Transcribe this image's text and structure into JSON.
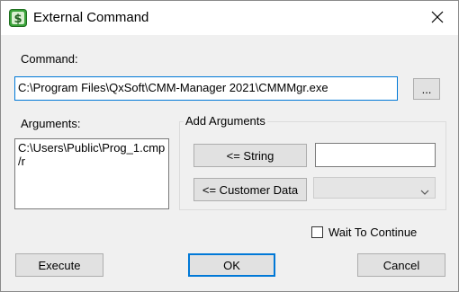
{
  "window": {
    "title": "External Command",
    "close_icon": "close-icon",
    "app_icon": "dollar-app-icon"
  },
  "command": {
    "label": "Command:",
    "value": "C:\\Program Files\\QxSoft\\CMM-Manager 2021\\CMMMgr.exe",
    "browse_label": "..."
  },
  "arguments": {
    "label": "Arguments:",
    "lines": [
      "C:\\Users\\Public\\Prog_1.cmp",
      "/r"
    ]
  },
  "add_arguments": {
    "title": "Add Arguments",
    "string_button": "<= String",
    "string_value": "",
    "customer_data_button": "<= Customer Data",
    "customer_data_selected": ""
  },
  "wait_to_continue": {
    "label": "Wait To Continue",
    "checked": false
  },
  "buttons": {
    "execute": "Execute",
    "ok": "OK",
    "cancel": "Cancel"
  },
  "colors": {
    "focus_accent": "#0078d7",
    "dialog_bg": "#f0f0f0",
    "icon_green": "#3aa33a"
  }
}
